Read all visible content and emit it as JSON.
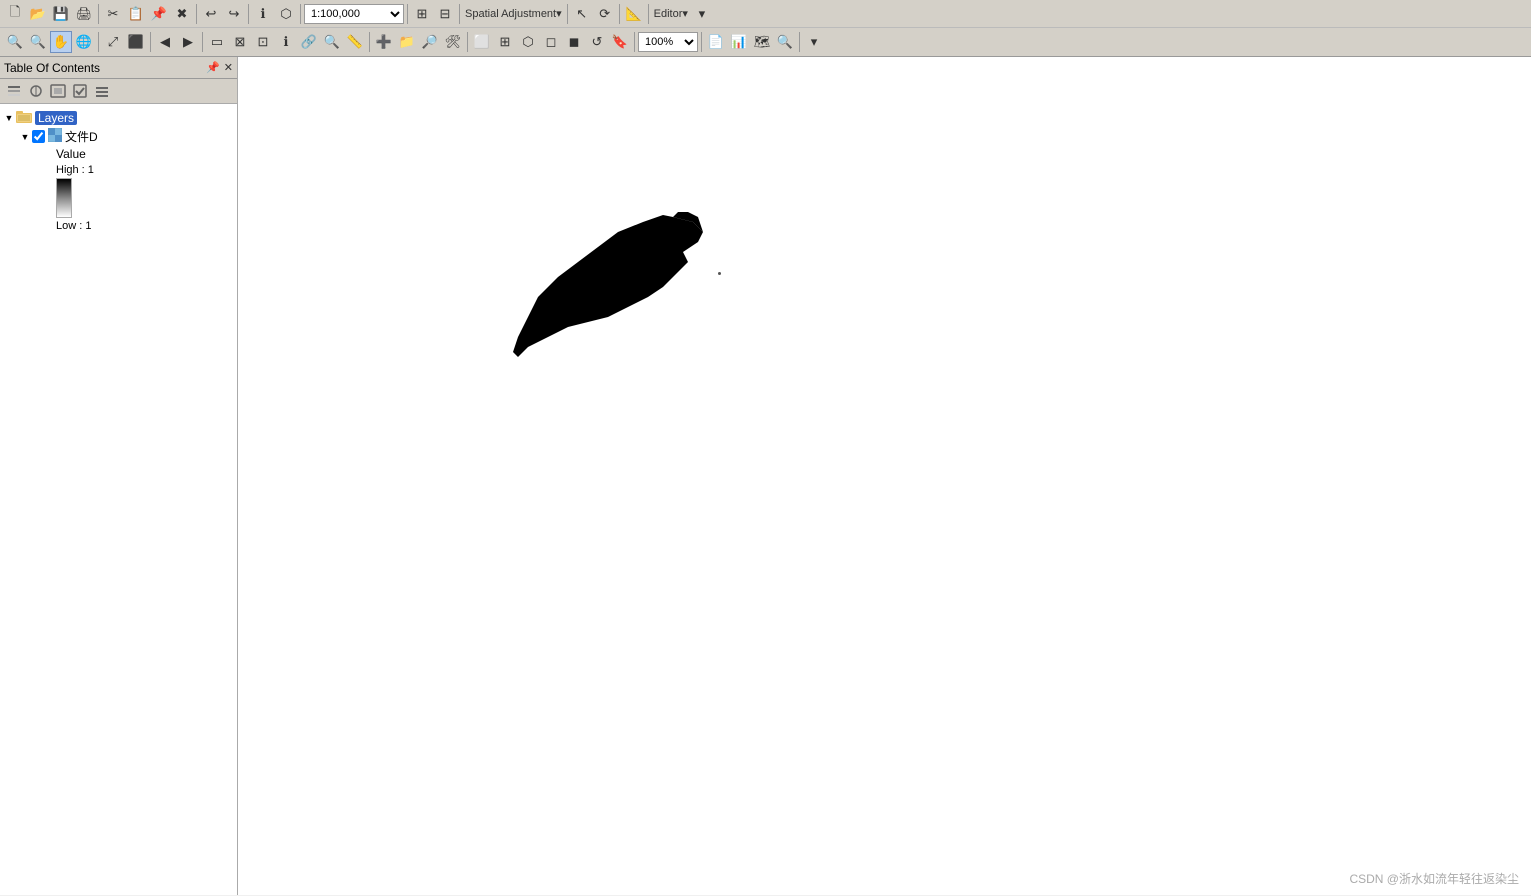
{
  "toolbar1": {
    "buttons": [
      {
        "name": "new-icon",
        "symbol": "🗋"
      },
      {
        "name": "open-icon",
        "symbol": "📂"
      },
      {
        "name": "save-icon",
        "symbol": "💾"
      },
      {
        "name": "print-icon",
        "symbol": "🖨"
      },
      {
        "name": "cut-icon",
        "symbol": "✂"
      },
      {
        "name": "copy-icon",
        "symbol": "📋"
      },
      {
        "name": "paste-icon",
        "symbol": "📌"
      },
      {
        "name": "delete-icon",
        "symbol": "✖"
      },
      {
        "name": "undo-icon",
        "symbol": "↩"
      },
      {
        "name": "redo-icon",
        "symbol": "↪"
      }
    ],
    "scale_value": "1:100,000",
    "spatial_adjustment_label": "Spatial Adjustment▾",
    "editor_label": "Editor▾"
  },
  "toolbar2": {
    "zoom_in_label": "+",
    "zoom_out_label": "−",
    "pan_label": "✋",
    "zoom_percent": "100%"
  },
  "toc": {
    "title": "Table Of Contents",
    "layers_group": "Layers",
    "layer_name": "文件D",
    "legend_title": "Value",
    "high_label": "High : 1",
    "low_label": "Low : 1"
  },
  "map": {
    "watermark": "CSDN @浙水如流年轻往返染尘"
  }
}
